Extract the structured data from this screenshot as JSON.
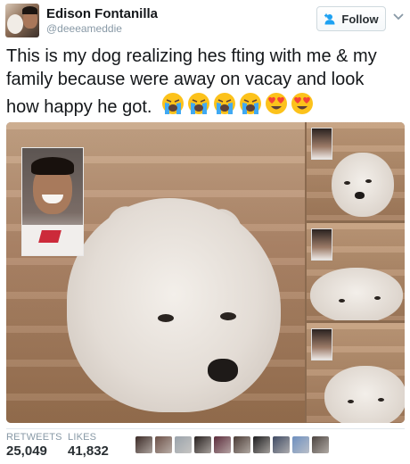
{
  "user": {
    "display_name": "Edison Fontanilla",
    "handle": "@deeeameddie",
    "avatar_icon": "profile-photo"
  },
  "follow_button": {
    "label": "Follow",
    "icon": "add-user-icon"
  },
  "caret_icon": "chevron-down-icon",
  "tweet": {
    "text": "This is my dog realizing hes fting with me & my family because were away on vacay and look how happy he got.",
    "emojis": [
      "loudly-crying-face",
      "loudly-crying-face",
      "loudly-crying-face",
      "loudly-crying-face",
      "heart-eyes-face",
      "heart-eyes-face"
    ]
  },
  "media": {
    "photos": [
      "dog-facetime-main",
      "dog-facetime-thumb-1",
      "dog-facetime-thumb-2",
      "dog-facetime-thumb-3"
    ]
  },
  "stats": {
    "retweets_label": "RETWEETS",
    "retweets_count": "25,049",
    "likes_label": "LIKES",
    "likes_count": "41,832"
  },
  "likers": [
    "#3b2a26",
    "#6b5047",
    "#9aa3ab",
    "#27201f",
    "#5a2b3a",
    "#4a3b35",
    "#1d1d1f",
    "#3e4a63",
    "#6d8fbf",
    "#4c4440"
  ],
  "colors": {
    "text": "#14171a",
    "muted": "#8899a6",
    "follow_icon": "#1da1f2"
  }
}
